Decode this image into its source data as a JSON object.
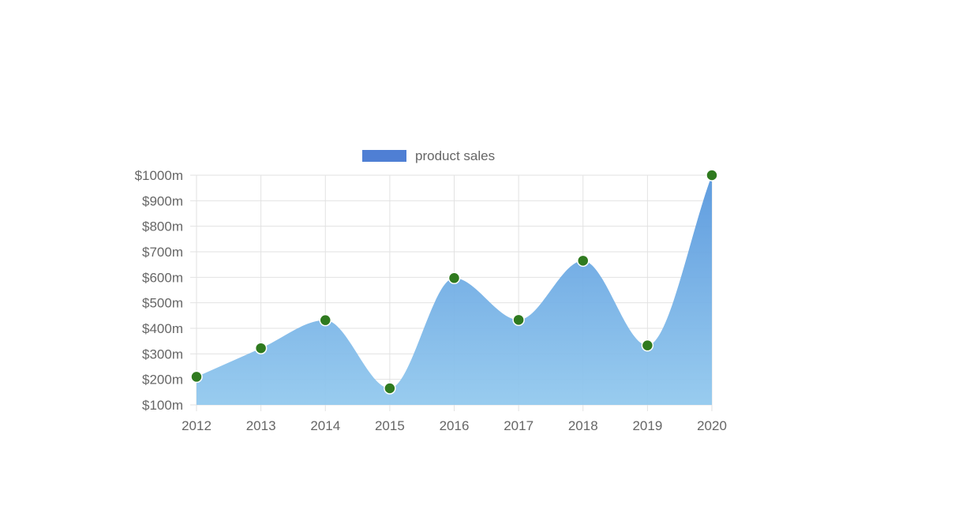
{
  "chart_data": {
    "type": "area",
    "x": [
      "2012",
      "2013",
      "2014",
      "2015",
      "2016",
      "2017",
      "2018",
      "2019",
      "2020"
    ],
    "series": [
      {
        "name": "product sales",
        "values": [
          210,
          322,
          432,
          165,
          597,
          433,
          665,
          333,
          1000
        ]
      }
    ],
    "y_ticks": [
      "$100m",
      "$200m",
      "$300m",
      "$400m",
      "$500m",
      "$600m",
      "$700m",
      "$800m",
      "$900m",
      "$1000m"
    ],
    "ylim": [
      100,
      1000
    ],
    "grid": true,
    "legend_position": "top",
    "colors": {
      "legend_swatch": "#4f7fd4",
      "area_top": "#5797dd",
      "area_bottom": "#93c9ee",
      "point_fill": "#2f7a1f",
      "point_stroke": "#ffffff",
      "grid": "#e2e2e2",
      "text": "#666666"
    }
  }
}
